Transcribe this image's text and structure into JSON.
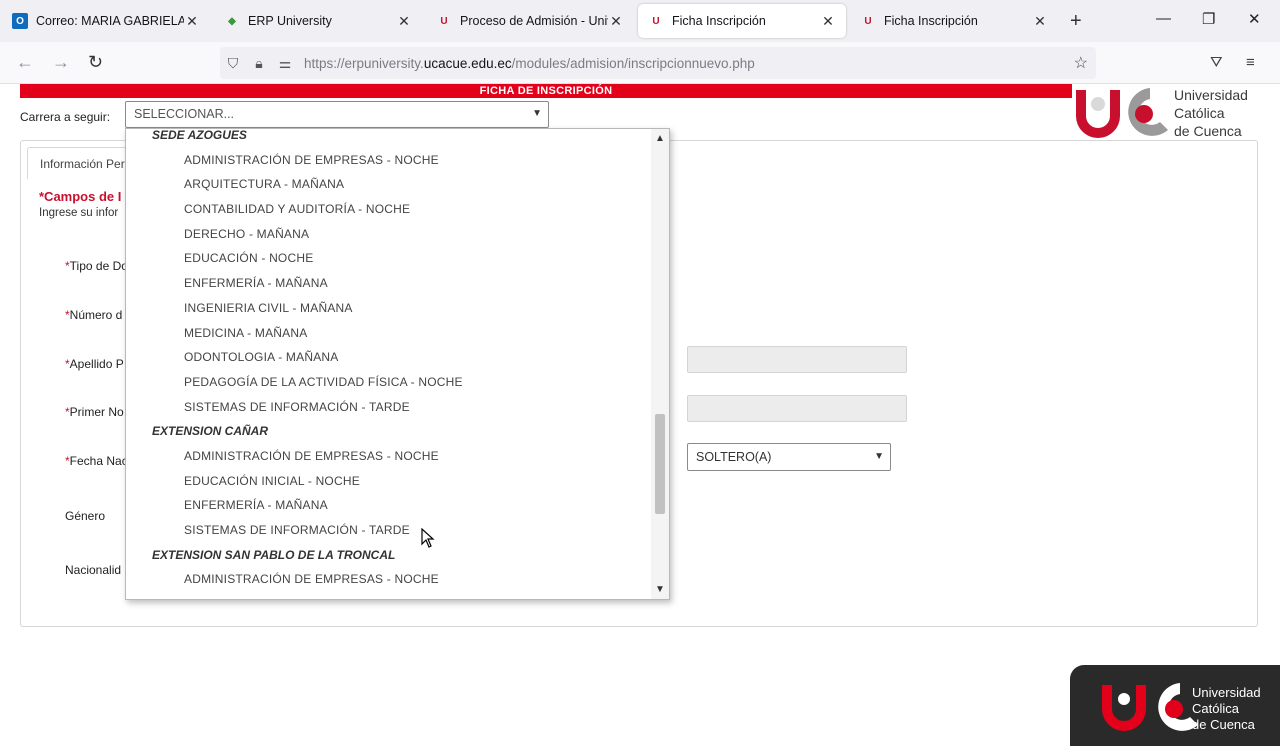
{
  "browser": {
    "tabs": [
      {
        "label": "Correo: MARIA GABRIELA VICUÑA",
        "icon": "outlook-icon"
      },
      {
        "label": "ERP University",
        "icon": "erp-icon"
      },
      {
        "label": "Proceso de Admisión - Universidad",
        "icon": "uc-icon"
      },
      {
        "label": "Ficha Inscripción",
        "icon": "uc-icon"
      },
      {
        "label": "Ficha Inscripción",
        "icon": "uc-icon"
      }
    ],
    "new_tab": "+",
    "url_prefix": "https://erpuniversity.",
    "url_domain": "ucacue.edu.ec",
    "url_path": "/modules/admision/inscripcionnuevo.php"
  },
  "page": {
    "banner_title": "FICHA DE INSCRIPCIÓN",
    "carrera_label": "Carrera a seguir:",
    "carrera_selected": "SELECCIONAR...",
    "logo_line1": "Universidad",
    "logo_line2": "Católica",
    "logo_line3": "de Cuenca",
    "tab_info": "Información Per",
    "campos": "*Campos de I",
    "ingrese": "Ingrese su infor",
    "fields": {
      "tipo": "Tipo de Do",
      "numero": "Número d",
      "apellido": "Apellido P",
      "primer": "Primer No",
      "fecha": "Fecha Nac",
      "genero": "Género",
      "nacionalidad": "Nacionalid"
    },
    "req_mark": "*",
    "estado_civil": "SOLTERO(A)"
  },
  "dropdown": {
    "items": [
      {
        "kind": "group",
        "label": "SEDE AZOGUES"
      },
      {
        "kind": "option",
        "label": "ADMINISTRACIÓN DE EMPRESAS - NOCHE"
      },
      {
        "kind": "option",
        "label": "ARQUITECTURA - MAÑANA"
      },
      {
        "kind": "option",
        "label": "CONTABILIDAD Y AUDITORÍA - NOCHE"
      },
      {
        "kind": "option",
        "label": "DERECHO - MAÑANA"
      },
      {
        "kind": "option",
        "label": "EDUCACIÓN - NOCHE"
      },
      {
        "kind": "option",
        "label": "ENFERMERÍA - MAÑANA"
      },
      {
        "kind": "option",
        "label": "INGENIERIA CIVIL - MAÑANA"
      },
      {
        "kind": "option",
        "label": "MEDICINA - MAÑANA"
      },
      {
        "kind": "option",
        "label": "ODONTOLOGIA - MAÑANA"
      },
      {
        "kind": "option",
        "label": "PEDAGOGÍA DE LA ACTIVIDAD FÍSICA - NOCHE"
      },
      {
        "kind": "option",
        "label": "SISTEMAS DE INFORMACIÓN - TARDE"
      },
      {
        "kind": "group",
        "label": "EXTENSION CAÑAR"
      },
      {
        "kind": "option",
        "label": "ADMINISTRACIÓN DE EMPRESAS - NOCHE"
      },
      {
        "kind": "option",
        "label": "EDUCACIÓN INICIAL - NOCHE"
      },
      {
        "kind": "option",
        "label": "ENFERMERÍA - MAÑANA"
      },
      {
        "kind": "option",
        "label": "SISTEMAS DE INFORMACIÓN - TARDE"
      },
      {
        "kind": "group",
        "label": "EXTENSION SAN PABLO DE LA TRONCAL"
      },
      {
        "kind": "option",
        "label": "ADMINISTRACIÓN DE EMPRESAS - NOCHE"
      }
    ]
  },
  "watermark": {
    "line1": "Universidad",
    "line2": "Católica",
    "line3": "de Cuenca"
  },
  "colors": {
    "brand_red": "#e2001a",
    "required": "#c8102e"
  }
}
